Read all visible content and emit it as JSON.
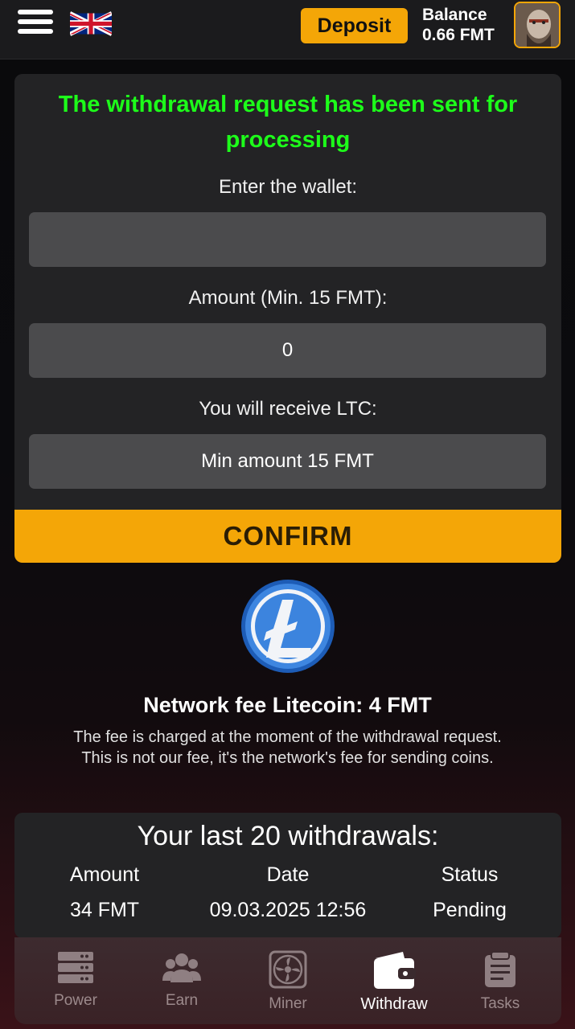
{
  "header": {
    "menu_icon": "hamburger-menu-icon",
    "language_flag": "uk-flag-icon",
    "deposit_label": "Deposit",
    "balance_label": "Balance",
    "balance_value": "0.66 FMT",
    "accent_color": "#f4a607"
  },
  "form": {
    "status_message": "The withdrawal request has been sent for processing",
    "status_color": "#1dff1a",
    "wallet_label": "Enter the wallet:",
    "wallet_value": "",
    "amount_label": "Amount (Min. 15 FMT):",
    "amount_value": "0",
    "receive_label": "You will receive LTC:",
    "receive_value": "Min amount 15 FMT",
    "confirm_label": "CONFIRM"
  },
  "fee_info": {
    "coin_icon": "litecoin-icon",
    "title": "Network fee Litecoin: 4 FMT",
    "description": "The fee is charged at the moment of the withdrawal request. This is not our fee, it's the network's fee for sending coins."
  },
  "withdrawals": {
    "title": "Your last 20 withdrawals:",
    "columns": [
      "Amount",
      "Date",
      "Status"
    ],
    "rows": [
      {
        "amount": "34 FMT",
        "date": "09.03.2025 12:56",
        "status": "Pending"
      }
    ]
  },
  "nav": {
    "items": [
      {
        "label": "Power",
        "icon": "server-icon"
      },
      {
        "label": "Earn",
        "icon": "users-icon"
      },
      {
        "label": "Miner",
        "icon": "fan-icon"
      },
      {
        "label": "Withdraw",
        "icon": "wallet-icon",
        "active": true
      },
      {
        "label": "Tasks",
        "icon": "tasks-icon"
      }
    ]
  }
}
